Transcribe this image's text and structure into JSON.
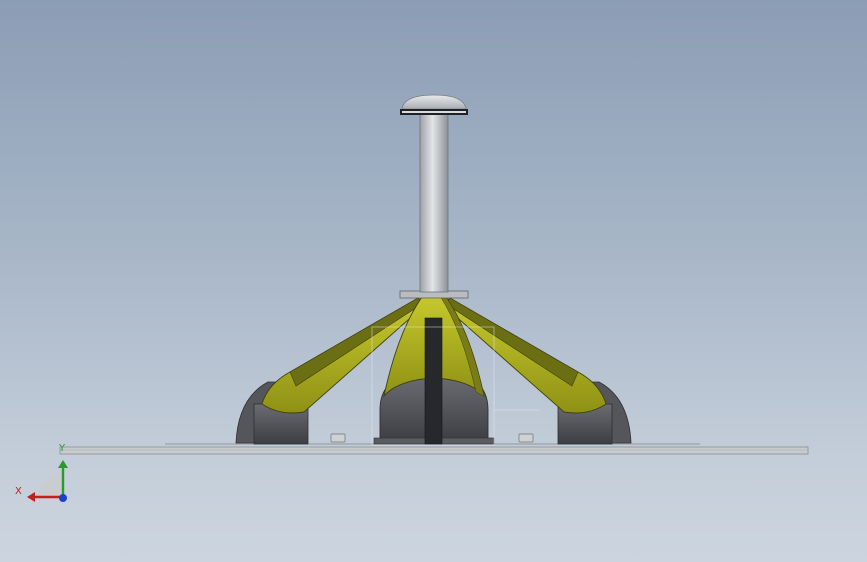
{
  "viewport": {
    "background_top": "#8b9db5",
    "background_bottom": "#ccd5df"
  },
  "model": {
    "arm_color": "#b4b61e",
    "arm_dark_color": "#5e6012",
    "housing_color": "#4a4c52",
    "mast_color": "#c4c7cc",
    "base_plate_color": "#c9cccf"
  },
  "triad": {
    "x_label": "X",
    "y_label": "Y",
    "x_color": "#c02020",
    "y_color": "#2a9a2a",
    "z_color": "#1d3fcf",
    "icon": "axis-triad-icon"
  }
}
